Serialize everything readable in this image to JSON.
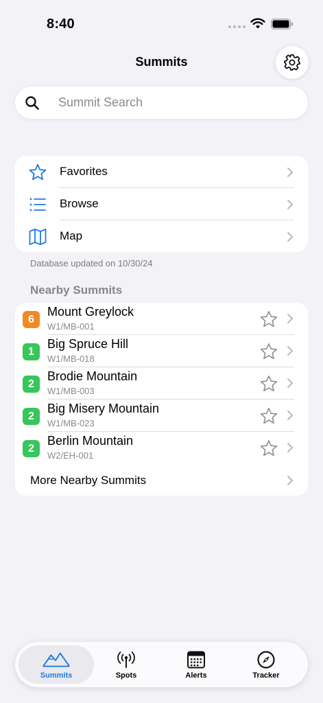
{
  "status_bar": {
    "time": "8:40"
  },
  "nav": {
    "title": "Summits"
  },
  "search": {
    "placeholder": "Summit Search",
    "value": ""
  },
  "menu": {
    "items": [
      {
        "label": "Favorites",
        "icon": "star-outline-icon"
      },
      {
        "label": "Browse",
        "icon": "list-icon"
      },
      {
        "label": "Map",
        "icon": "map-icon"
      }
    ]
  },
  "database_status": "Database updated on 10/30/24",
  "nearby": {
    "header": "Nearby Summits",
    "items": [
      {
        "points": "6",
        "name": "Mount Greylock",
        "code": "W1/MB-001",
        "badge_color": "#f08a24"
      },
      {
        "points": "1",
        "name": "Big Spruce Hill",
        "code": "W1/MB-018",
        "badge_color": "#35c759"
      },
      {
        "points": "2",
        "name": "Brodie Mountain",
        "code": "W1/MB-003",
        "badge_color": "#35c759"
      },
      {
        "points": "2",
        "name": "Big Misery Mountain",
        "code": "W1/MB-023",
        "badge_color": "#35c759"
      },
      {
        "points": "2",
        "name": "Berlin Mountain",
        "code": "W2/EH-001",
        "badge_color": "#35c759"
      }
    ],
    "more_label": "More Nearby Summits"
  },
  "tabs": [
    {
      "label": "Summits",
      "icon": "mountains-icon",
      "active": true
    },
    {
      "label": "Spots",
      "icon": "antenna-icon",
      "active": false
    },
    {
      "label": "Alerts",
      "icon": "calendar-icon",
      "active": false
    },
    {
      "label": "Tracker",
      "icon": "compass-icon",
      "active": false
    }
  ],
  "colors": {
    "accent": "#1e7be0",
    "background": "#f2f2f7",
    "secondary_text": "#8a8a8e"
  }
}
